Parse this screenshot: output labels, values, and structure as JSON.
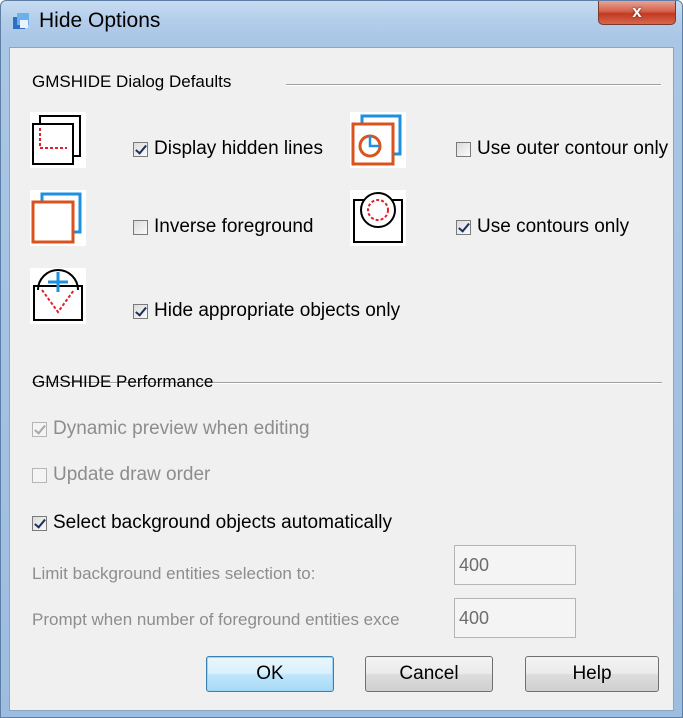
{
  "window": {
    "title": "Hide Options",
    "close_label": "x",
    "icons": [
      "app-icon",
      "close-icon"
    ]
  },
  "defaults_group": {
    "label": "GMSHIDE Dialog Defaults",
    "options": [
      {
        "label": "Display hidden lines",
        "checked": true,
        "icon": "hidden-lines-icon"
      },
      {
        "label": "Use outer contour only",
        "checked": false,
        "icon": "outer-contour-icon"
      },
      {
        "label": "Inverse foreground",
        "checked": false,
        "icon": "inverse-foreground-icon"
      },
      {
        "label": "Use contours only",
        "checked": true,
        "icon": "contours-only-icon"
      },
      {
        "label": "Hide appropriate objects only",
        "checked": true,
        "icon": "appropriate-objects-icon"
      }
    ]
  },
  "performance_group": {
    "label": "GMSHIDE Performance",
    "dynamic_preview": {
      "label": "Dynamic preview when editing",
      "checked": true,
      "enabled": false
    },
    "update_draw_order": {
      "label": "Update draw order",
      "checked": false,
      "enabled": false
    },
    "select_background": {
      "label": "Select background objects automatically",
      "checked": true,
      "enabled": true
    },
    "limit_background": {
      "label": "Limit background entities selection to:",
      "value": "400"
    },
    "prompt_foreground": {
      "label": "Prompt when number of foreground entities exce",
      "value": "400"
    }
  },
  "buttons": {
    "ok": "OK",
    "cancel": "Cancel",
    "help": "Help"
  },
  "colors": {
    "accent_orange": "#d9531e",
    "accent_blue": "#1e90e0",
    "hidden_red": "#e0202a"
  }
}
